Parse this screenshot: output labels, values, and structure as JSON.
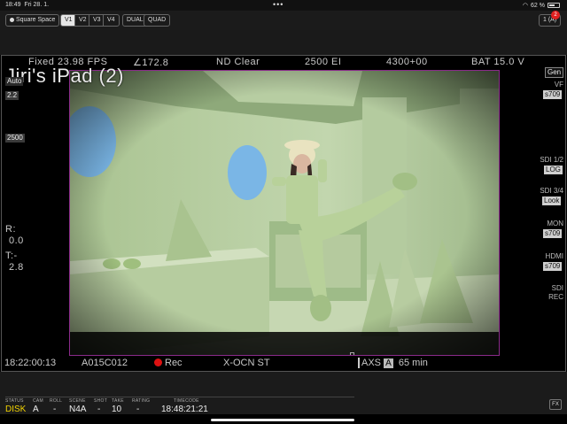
{
  "status_bar": {
    "time": "18:49",
    "date": "Fri 28. 1.",
    "dots": "•••",
    "battery": "62 %",
    "battery_level": 0.62
  },
  "toolbar": {
    "square_space": "Square Space",
    "views": [
      "V1",
      "V2",
      "V3",
      "V4"
    ],
    "active_view": "V1",
    "dual": "DUAL",
    "quad": "QUAD",
    "device": "1 (A)",
    "badge": "2"
  },
  "monitor": {
    "top": {
      "fps": "Fixed 23.98 FPS",
      "shutter": "172.8",
      "nd": "ND Clear",
      "ei": "2500 EI",
      "wb": "4300+00",
      "batt": "BAT 15.0 V"
    },
    "device_name": "Jiri's iPad (2)",
    "left": {
      "auto": "Auto",
      "ratio": "2.2",
      "iso": "2500",
      "r_label": "R:",
      "r_val": "0.0",
      "t_label": "T:-",
      "t_val": "2.8"
    },
    "right": {
      "gen": "Gen",
      "vf_label": "VF",
      "vf_val": "s709",
      "sdi12_label": "SDI 1/2",
      "sdi12_val": "LOG",
      "sdi34_label": "SDI 3/4",
      "sdi34_val": "Look",
      "mon_label": "MON",
      "mon_val": "s709",
      "hdmi_label": "HDMI",
      "hdmi_val": "s709",
      "sdi_rec_1": "SDI",
      "sdi_rec_2": "REC"
    },
    "bottom": {
      "tc": "18:22:00:13",
      "clip": "A015C012",
      "rec": "Rec",
      "media": "X-OCN ST",
      "axs": "AXS",
      "axs_slot": "A",
      "remaining": "65 min"
    }
  },
  "metadata": {
    "status": {
      "label": "STATUS",
      "value": "DISK"
    },
    "cam": {
      "label": "CAM",
      "value": "A"
    },
    "roll": {
      "label": "ROLL",
      "value": "-"
    },
    "scene": {
      "label": "SCENE",
      "value": "N4A"
    },
    "shot": {
      "label": "SHOT",
      "value": "-"
    },
    "take": {
      "label": "TAKE",
      "value": "10"
    },
    "rating": {
      "label": "RATING",
      "value": "-"
    },
    "timecode": {
      "label": "TIMECODE",
      "value": "18:48:21:21"
    },
    "fx": "FX"
  },
  "colors": {
    "accent_yellow": "#f2d300",
    "rec_red": "#d11111",
    "frame_line": "#8a2b8a"
  }
}
